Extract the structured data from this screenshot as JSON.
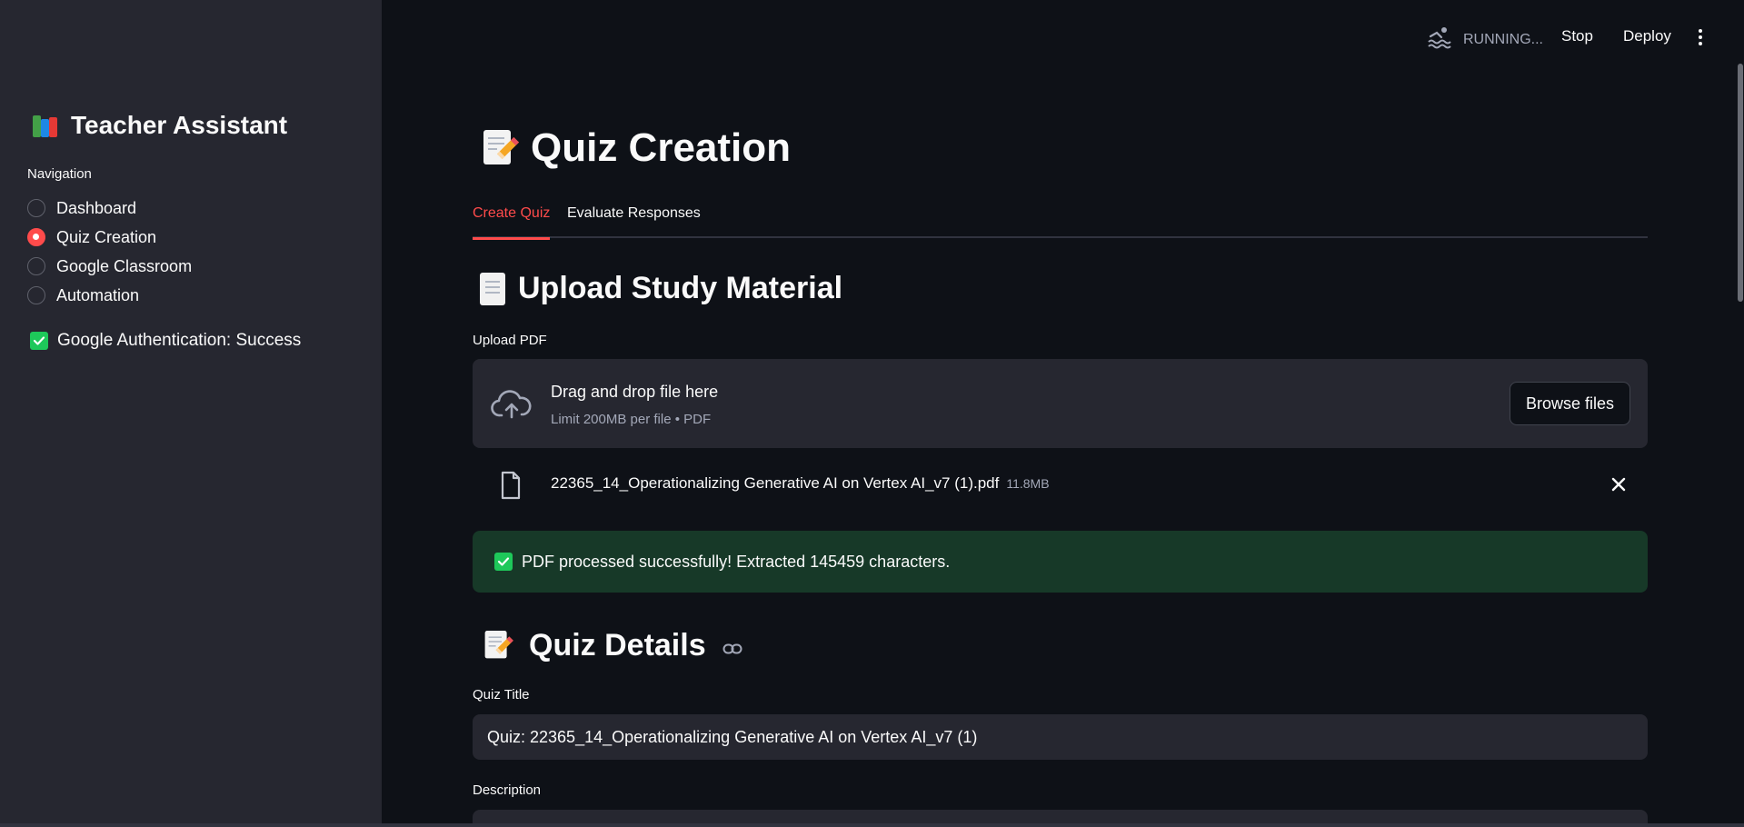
{
  "sidebar": {
    "title": "Teacher Assistant",
    "title_icon": "books-icon",
    "nav_label": "Navigation",
    "items": [
      {
        "label": "Dashboard",
        "selected": false
      },
      {
        "label": "Quiz Creation",
        "selected": true
      },
      {
        "label": "Google Classroom",
        "selected": false
      },
      {
        "label": "Automation",
        "selected": false
      }
    ],
    "auth_status": "Google Authentication: Success"
  },
  "topbar": {
    "status": "RUNNING...",
    "stop_label": "Stop",
    "deploy_label": "Deploy"
  },
  "main": {
    "title": "Quiz Creation",
    "tabs": [
      {
        "label": "Create Quiz",
        "active": true
      },
      {
        "label": "Evaluate Responses",
        "active": false
      }
    ],
    "upload_section": {
      "heading": "Upload Study Material",
      "field_label": "Upload PDF",
      "drop_text": "Drag and drop file here",
      "limit_text": "Limit 200MB per file • PDF",
      "browse_label": "Browse files",
      "file_name": "22365_14_Operationalizing Generative AI on Vertex AI_v7 (1).pdf",
      "file_size": "11.8MB",
      "success_message": "PDF processed successfully! Extracted 145459 characters."
    },
    "details_section": {
      "heading": "Quiz Details",
      "quiz_title_label": "Quiz Title",
      "quiz_title_value": "Quiz: 22365_14_Operationalizing Generative AI on Vertex AI_v7 (1)",
      "description_label": "Description"
    }
  },
  "colors": {
    "background": "#0e1117",
    "sidebar": "#262730",
    "accent": "#ff4b4b",
    "success_bg": "#173928",
    "success_check": "#1ec85a"
  }
}
